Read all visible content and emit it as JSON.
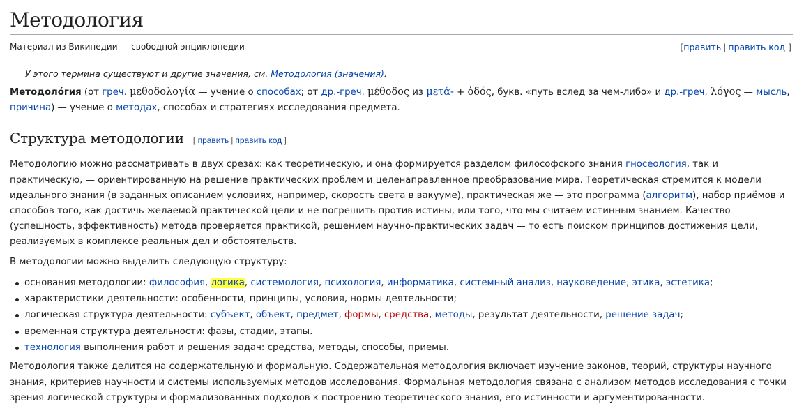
{
  "title": "Методология",
  "site_sub": "Материал из Википедии — свободной энциклопедии",
  "edit_links": {
    "edit": "править",
    "edit_source": "править код"
  },
  "hatnote": {
    "text": "У этого термина существуют и другие значения, см. ",
    "link": "Методология (значения)",
    "end": "."
  },
  "lead": {
    "term": "Методоло́гия",
    "t1": " (от ",
    "greek_abbr_1": "греч.",
    "greek_word_1": "μεθοδολογία",
    "t2": " — учение о ",
    "link_sposobah": "способах",
    "t3": "; от ",
    "ancient_greek_abbr": "др.-греч.",
    "greek_word_2": "μέθοδος",
    "t4": " из ",
    "greek_meta": "μετά-",
    "t5": " + ",
    "greek_word_3": "ὁδός",
    "t6": ", букв. «путь вслед за чем-либо» и ",
    "ancient_greek_abbr_2": "др.-греч.",
    "greek_logos": "λόγος",
    "t7": " — ",
    "link_mysl": "мысль",
    "t8": ", ",
    "link_prichina": "причина",
    "t9": ") — учение о ",
    "link_metodah": "методах",
    "t10": ", способах и стратегиях исследования предмета."
  },
  "section": {
    "heading": "Структура методологии",
    "p1_a": "Методологию можно рассматривать в двух срезах: как теоретическую, и она формируется разделом философского знания ",
    "p1_link_gnoseology": "гносеология",
    "p1_b": ", так и практическую, — ориентированную на решение практических проблем и целенаправленное преобразование мира. Теоретическая стремится к модели идеального знания (в заданных описанием условиях, например, скорость света в вакууме), практическая же — это программа (",
    "p1_link_algorithm": "алгоритм",
    "p1_c": "), набор приёмов и способов того, как достичь желаемой практической цели и не погрешить против истины, или того, что мы считаем истинным знанием. Качество (успешность, эффективность) метода проверяется практикой, решением научно-практических задач — то есть поиском принципов достижения цели, реализуемых в комплексе реальных дел и обстоятельств.",
    "p2": "В методологии можно выделить следующую структуру:",
    "list": {
      "item1": {
        "prefix": "основания методологии: ",
        "links": [
          "философия",
          "логика",
          "системология",
          "психология",
          "информатика",
          "системный анализ",
          "науковедение",
          "этика",
          "эстетика"
        ],
        "sep": ", ",
        "end": ";"
      },
      "item2": "характеристики деятельности: особенности, принципы, условия, нормы деятельности;",
      "item3": {
        "prefix": "логическая структура деятельности: ",
        "l1": "субъект",
        "l2": "объект",
        "l3": "предмет",
        "l4": "формы",
        "l5": "средства",
        "l6": "методы",
        "mid": "результат деятельности",
        "l7": "решение задач",
        "sep": ", ",
        "end": ";"
      },
      "item4": "временная структура деятельности: фазы, стадии, этапы.",
      "item5": {
        "link": "технология",
        "rest": " выполнения работ и решения задач: средства, методы, способы, приемы."
      }
    },
    "p3": "Методология также делится на содержательную и формальную. Содержательная методология включает изучение законов, теорий, структуры научного знания, критериев научности и системы используемых методов исследования. Формальная методология связана с анализом методов исследования с точки зрения логической структуры и формализованных подходов к построению теоретического знания, его истинности и аргументированности."
  },
  "colors": {
    "link": "#0645ad",
    "redlink": "#ba0000",
    "highlight": "#ffff44",
    "text": "#202122",
    "rule": "#a2a9b1"
  }
}
